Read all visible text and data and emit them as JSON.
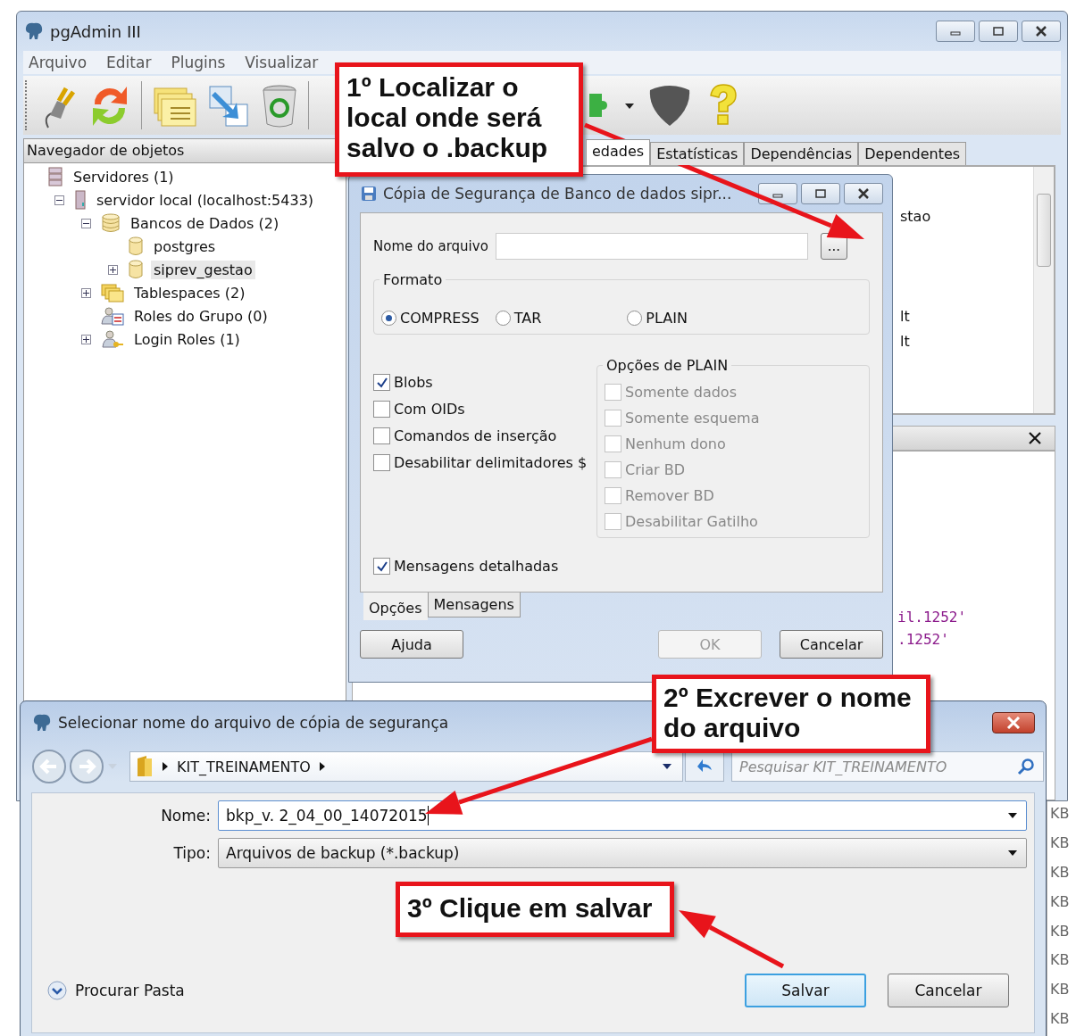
{
  "main_window": {
    "title": "pgAdmin III",
    "menu": [
      "Arquivo",
      "Editar",
      "Plugins",
      "Visualizar"
    ],
    "object_browser": {
      "title": "Navegador de objetos",
      "tree": [
        {
          "label": "Servidores (1)",
          "kind": "server-group",
          "selected": false,
          "children": [
            {
              "label": "servidor local (localhost:5433)",
              "kind": "server",
              "expanded": true,
              "selected": false,
              "children": [
                {
                  "label": "Bancos de Dados (2)",
                  "kind": "databases",
                  "expanded": true,
                  "selected": false,
                  "children": [
                    {
                      "label": "postgres",
                      "kind": "database",
                      "selected": false
                    },
                    {
                      "label": "siprev_gestao",
                      "kind": "database",
                      "expanded": false,
                      "selected": true
                    }
                  ]
                },
                {
                  "label": "Tablespaces (2)",
                  "kind": "tablespaces",
                  "expanded": false,
                  "selected": false
                },
                {
                  "label": "Roles do Grupo (0)",
                  "kind": "group-roles",
                  "selected": false
                },
                {
                  "label": "Login Roles (1)",
                  "kind": "login-roles",
                  "expanded": false,
                  "selected": false
                }
              ]
            }
          ]
        }
      ]
    },
    "tabs": [
      {
        "label": "edades",
        "selected": true
      },
      {
        "label": "Estatísticas",
        "selected": false
      },
      {
        "label": "Dependências",
        "selected": false
      },
      {
        "label": "Dependentes",
        "selected": false
      }
    ],
    "properties_lines": [
      "stao",
      "lt",
      "lt"
    ],
    "sql_lines": [
      "il.1252'",
      ".1252'"
    ]
  },
  "backup_dialog": {
    "title": "Cópia de Segurança de Banco de dados sipr...",
    "filename_label": "Nome do arquivo",
    "browse_button": "...",
    "format": {
      "legend": "Formato",
      "options": [
        {
          "label": "COMPRESS",
          "selected": true
        },
        {
          "label": "TAR",
          "selected": false
        },
        {
          "label": "PLAIN",
          "selected": false
        }
      ]
    },
    "options": [
      {
        "label": "Blobs",
        "checked": true
      },
      {
        "label": "Com OIDs",
        "checked": false
      },
      {
        "label": "Comandos de inserção",
        "checked": false
      },
      {
        "label": "Desabilitar delimitadores $",
        "checked": false
      }
    ],
    "plain_options": {
      "legend": "Opções de PLAIN",
      "items": [
        {
          "label": "Somente dados",
          "checked": false,
          "disabled": true
        },
        {
          "label": "Somente esquema",
          "checked": false,
          "disabled": true
        },
        {
          "label": "Nenhum dono",
          "checked": false,
          "disabled": true
        },
        {
          "label": "Criar BD",
          "checked": false,
          "disabled": true
        },
        {
          "label": "Remover BD",
          "checked": false,
          "disabled": true
        },
        {
          "label": "Desabilitar Gatilho",
          "checked": false,
          "disabled": true
        }
      ]
    },
    "verbose": {
      "label": "Mensagens detalhadas",
      "checked": true
    },
    "tabs": [
      {
        "label": "Opções",
        "selected": true
      },
      {
        "label": "Mensagens",
        "selected": false
      }
    ],
    "buttons": [
      {
        "label": "Ajuda",
        "disabled": false
      },
      {
        "label": "OK",
        "disabled": true
      },
      {
        "label": "Cancelar",
        "disabled": false
      }
    ]
  },
  "save_dialog": {
    "title": "Selecionar nome do arquivo de cópia de segurança",
    "breadcrumb": [
      "KIT_TREINAMENTO"
    ],
    "search": {
      "placeholder": "Pesquisar KIT_TREINAMENTO"
    },
    "fields": [
      {
        "label": "Nome:",
        "value": "bkp_v. 2_04_00_14072015",
        "kind": "input"
      },
      {
        "label": "Tipo:",
        "value": "Arquivos de backup (*.backup)",
        "kind": "select"
      }
    ],
    "browse_folders": "Procurar Pasta",
    "buttons": [
      {
        "label": "Salvar",
        "default": true
      },
      {
        "label": "Cancelar",
        "default": false
      }
    ]
  },
  "size_column": [
    "KB",
    "KB",
    "KB",
    "KB",
    "KB",
    "KB",
    "KB",
    "KB"
  ],
  "callouts": [
    "1º Localizar o local onde será salvo o .backup",
    "2º Excrever o nome do arquivo",
    "3º Clique em salvar"
  ]
}
